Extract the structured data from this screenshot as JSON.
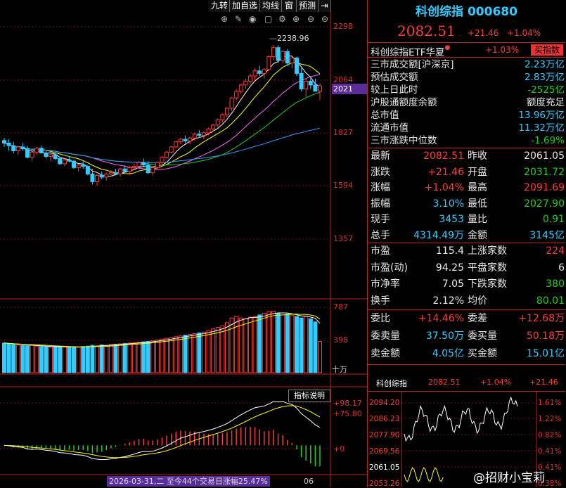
{
  "toolbar": {
    "buttons": [
      "九转",
      "加自选",
      "均线",
      "窗",
      "预测"
    ],
    "colors": {
      "bg": "#000000",
      "up": "#ff3b3b",
      "down": "#1fd11f",
      "cyan": "#33ccff",
      "axis": "#b22222"
    }
  },
  "price_axis": [
    "2298",
    "2064",
    "2021",
    "1827",
    "1594",
    "1357"
  ],
  "peak_label": "2238.96",
  "volume_axis": [
    "787",
    "398"
  ],
  "volume_unit": "十万",
  "indicator": {
    "button": "指标说明",
    "labels": [
      "+98.17",
      "+75.80",
      "+0"
    ],
    "bottom_date": "2026-03-31,二 至今44个交易日涨幅25.47%",
    "bottom_tick": "06"
  },
  "header": {
    "title": "科创综指 000680",
    "price": "2082.51",
    "change": "+21.46",
    "pct": "+1.04%"
  },
  "etf": {
    "name": "科创综指ETF华夏",
    "pct": "+1.03%",
    "buy": "买指数"
  },
  "stats": [
    {
      "k": "三市成交额[沪深京]",
      "v": "2.23万亿",
      "c": "cyan"
    },
    {
      "k": "预估成交额",
      "v": "2.83万亿",
      "c": "cyan"
    },
    {
      "k": "较上日此时",
      "v": "-2525亿",
      "c": "green"
    },
    {
      "k": "沪股通额度余额",
      "v": "额度充足",
      "c": "white"
    },
    {
      "k": "总市值",
      "v": "13.96万亿",
      "c": "cyan"
    },
    {
      "k": "流通市值",
      "v": "11.32万亿",
      "c": "cyan"
    },
    {
      "k": "三市涨跌中位数",
      "v": "-1.69%",
      "c": "green"
    }
  ],
  "quote": [
    {
      "k1": "最新",
      "v1": "2082.51",
      "c1": "red",
      "k2": "昨收",
      "v2": "2061.05",
      "c2": "white"
    },
    {
      "k1": "涨跌",
      "v1": "+21.46",
      "c1": "red",
      "k2": "开盘",
      "v2": "2031.72",
      "c2": "green"
    },
    {
      "k1": "涨幅",
      "v1": "+1.04%",
      "c1": "red",
      "k2": "最高",
      "v2": "2091.69",
      "c2": "red"
    },
    {
      "k1": "振幅",
      "v1": "3.10%",
      "c1": "cyan",
      "k2": "最低",
      "v2": "2027.90",
      "c2": "green"
    },
    {
      "k1": "现手",
      "v1": "3453",
      "c1": "cyan",
      "k2": "量比",
      "v2": "0.91",
      "c2": "green"
    },
    {
      "k1": "总手",
      "v1": "4314.49万",
      "c1": "cyan",
      "k2": "金额",
      "v2": "3145亿",
      "c2": "cyan"
    }
  ],
  "market": [
    {
      "k1": "市盈",
      "v1": "115.4",
      "k2": "上涨家数",
      "v2": "224",
      "c2": "red"
    },
    {
      "k1": "市盈(动)",
      "v1": "94.25",
      "k2": "平盘家数",
      "v2": "6",
      "c2": "white"
    },
    {
      "k1": "市净率",
      "v1": "7.05",
      "k2": "下跌家数",
      "v2": "380",
      "c2": "green"
    },
    {
      "k1": "换手",
      "v1": "2.12%",
      "k2": "均价",
      "v2": "80.01",
      "c2": "green"
    }
  ],
  "orders": [
    {
      "k1": "委比",
      "v1": "+14.46%",
      "c1": "red",
      "k2": "委差",
      "v2": "+12.68万",
      "c2": "red"
    },
    {
      "k1": "委卖量",
      "v1": "37.50万",
      "c1": "cyan",
      "k2": "委买量",
      "v2": "50.18万",
      "c2": "red"
    },
    {
      "k1": "卖金额",
      "v1": "4.05亿",
      "c1": "cyan",
      "k2": "买金额",
      "v2": "15.01亿",
      "c2": "cyan"
    }
  ],
  "mini": {
    "name": "科创综指",
    "price": "2082.51",
    "pct": "+1.04%",
    "chg": "+21.46",
    "left_axis": [
      "2094.20",
      "2086.23",
      "2077.90",
      "2069.56",
      "2061.05",
      "2053.26"
    ],
    "right_axis": [
      "1.61%",
      "1.22%",
      "0.82%",
      "0.41%",
      "0.41%",
      "0.38%"
    ]
  },
  "watermark": "@招财小宝莉",
  "chart_data": {
    "type": "candlestick",
    "candles": [
      [
        1870,
        1880,
        1845,
        1860
      ],
      [
        1860,
        1875,
        1830,
        1850
      ],
      [
        1850,
        1865,
        1820,
        1830
      ],
      [
        1830,
        1850,
        1815,
        1845
      ],
      [
        1845,
        1860,
        1830,
        1838
      ],
      [
        1838,
        1850,
        1800,
        1805
      ],
      [
        1805,
        1830,
        1790,
        1825
      ],
      [
        1825,
        1845,
        1815,
        1840
      ],
      [
        1840,
        1850,
        1820,
        1822
      ],
      [
        1822,
        1830,
        1800,
        1808
      ],
      [
        1808,
        1820,
        1790,
        1815
      ],
      [
        1815,
        1825,
        1795,
        1800
      ],
      [
        1800,
        1805,
        1775,
        1780
      ],
      [
        1780,
        1800,
        1770,
        1795
      ],
      [
        1795,
        1810,
        1785,
        1790
      ],
      [
        1790,
        1795,
        1760,
        1765
      ],
      [
        1765,
        1780,
        1750,
        1775
      ],
      [
        1775,
        1790,
        1760,
        1770
      ],
      [
        1770,
        1775,
        1735,
        1740
      ],
      [
        1740,
        1760,
        1700,
        1710
      ],
      [
        1710,
        1740,
        1695,
        1735
      ],
      [
        1735,
        1750,
        1720,
        1728
      ],
      [
        1728,
        1745,
        1715,
        1740
      ],
      [
        1740,
        1755,
        1730,
        1745
      ],
      [
        1745,
        1760,
        1735,
        1740
      ],
      [
        1740,
        1765,
        1730,
        1760
      ],
      [
        1760,
        1775,
        1745,
        1750
      ],
      [
        1750,
        1770,
        1735,
        1765
      ],
      [
        1765,
        1780,
        1755,
        1770
      ],
      [
        1770,
        1790,
        1760,
        1785
      ],
      [
        1785,
        1800,
        1770,
        1775
      ],
      [
        1775,
        1790,
        1740,
        1745
      ],
      [
        1745,
        1770,
        1735,
        1765
      ],
      [
        1765,
        1790,
        1760,
        1785
      ],
      [
        1785,
        1810,
        1780,
        1805
      ],
      [
        1805,
        1830,
        1800,
        1825
      ],
      [
        1825,
        1850,
        1820,
        1845
      ],
      [
        1845,
        1870,
        1840,
        1865
      ],
      [
        1865,
        1880,
        1855,
        1875
      ],
      [
        1875,
        1890,
        1860,
        1868
      ],
      [
        1868,
        1885,
        1855,
        1880
      ],
      [
        1880,
        1900,
        1870,
        1895
      ],
      [
        1895,
        1910,
        1880,
        1890
      ],
      [
        1890,
        1905,
        1875,
        1900
      ],
      [
        1900,
        1920,
        1890,
        1915
      ],
      [
        1915,
        1935,
        1905,
        1930
      ],
      [
        1930,
        1955,
        1920,
        1950
      ],
      [
        1950,
        1975,
        1940,
        1970
      ],
      [
        1970,
        2000,
        1960,
        1995
      ],
      [
        1995,
        2040,
        1985,
        2035
      ],
      [
        2035,
        2070,
        2025,
        2060
      ],
      [
        2060,
        2090,
        2050,
        2085
      ],
      [
        2085,
        2110,
        2070,
        2100
      ],
      [
        2100,
        2130,
        2090,
        2120
      ],
      [
        2120,
        2150,
        2105,
        2140
      ],
      [
        2140,
        2160,
        2120,
        2130
      ],
      [
        2130,
        2150,
        2110,
        2145
      ],
      [
        2145,
        2200,
        2140,
        2195
      ],
      [
        2195,
        2240,
        2180,
        2230
      ],
      [
        2230,
        2239,
        2170,
        2180
      ],
      [
        2180,
        2220,
        2170,
        2215
      ],
      [
        2215,
        2225,
        2160,
        2170
      ],
      [
        2170,
        2200,
        2150,
        2190
      ],
      [
        2190,
        2195,
        2120,
        2130
      ],
      [
        2130,
        2150,
        2060,
        2070
      ],
      [
        2070,
        2110,
        2040,
        2100
      ],
      [
        2100,
        2120,
        2070,
        2085
      ],
      [
        2085,
        2110,
        2060,
        2061
      ],
      [
        2061,
        2092,
        2028,
        2082
      ]
    ],
    "volume": [
      380,
      370,
      360,
      355,
      350,
      345,
      350,
      340,
      335,
      330,
      325,
      340,
      335,
      330,
      320,
      330,
      325,
      335,
      340,
      350,
      345,
      355,
      350,
      360,
      365,
      370,
      375,
      380,
      385,
      390,
      395,
      400,
      410,
      420,
      430,
      440,
      450,
      460,
      470,
      480,
      490,
      500,
      510,
      520,
      540,
      560,
      580,
      600,
      640,
      700,
      720,
      700,
      690,
      710,
      720,
      740,
      760,
      780,
      787,
      760,
      740,
      750,
      730,
      720,
      700,
      720,
      690,
      650,
      400
    ],
    "price_range": [
      1270,
      2360
    ],
    "volume_range": [
      0,
      900
    ],
    "macd_range": [
      -40,
      110
    ]
  }
}
